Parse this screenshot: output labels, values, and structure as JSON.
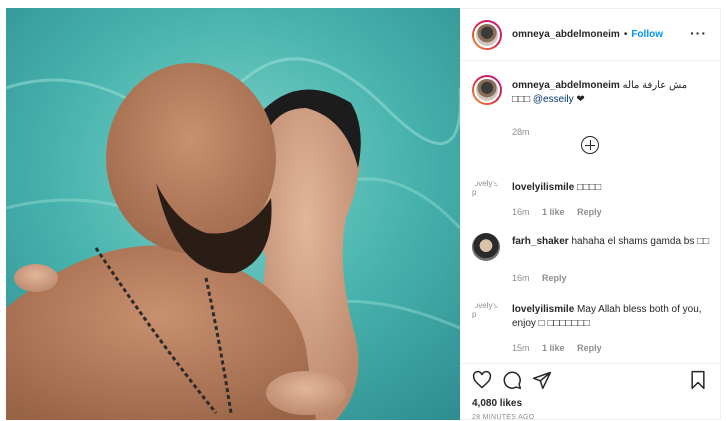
{
  "post": {
    "username": "omneya_abdelmoneim",
    "dot": "•",
    "follow_label": "Follow",
    "more": "···"
  },
  "caption": {
    "username": "omneya_abdelmoneim",
    "text_line1": "مش عارفة ماله",
    "text_line2_prefix": "□□□",
    "mention": "@esseily",
    "heart": "❤",
    "time": "28m"
  },
  "comments": [
    {
      "username": "lovelyilismile",
      "text": "□□□□",
      "time": "16m",
      "likes": "1 like",
      "reply": "Reply",
      "avatar_alt": "lovely's p"
    },
    {
      "username": "farh_shaker",
      "text": "hahaha el shams gamda bs □□",
      "time": "16m",
      "reply": "Reply"
    },
    {
      "username": "lovelyilismile",
      "text": "May Allah bless both of you, enjoy □ □□□□□□□",
      "time": "15m",
      "likes": "1 like",
      "reply": "Reply",
      "avatar_alt": "lovely's p"
    }
  ],
  "footer": {
    "likes": "4,080 likes",
    "posted": "28 MINUTES AGO"
  },
  "icons": [
    "heart-icon",
    "comment-icon",
    "share-icon",
    "bookmark-icon",
    "add-circle-icon",
    "more-icon"
  ],
  "colors": {
    "follow": "#0095f6",
    "mention": "#00376b",
    "muted": "#8e8e8e",
    "water": "#3aa6a8"
  }
}
